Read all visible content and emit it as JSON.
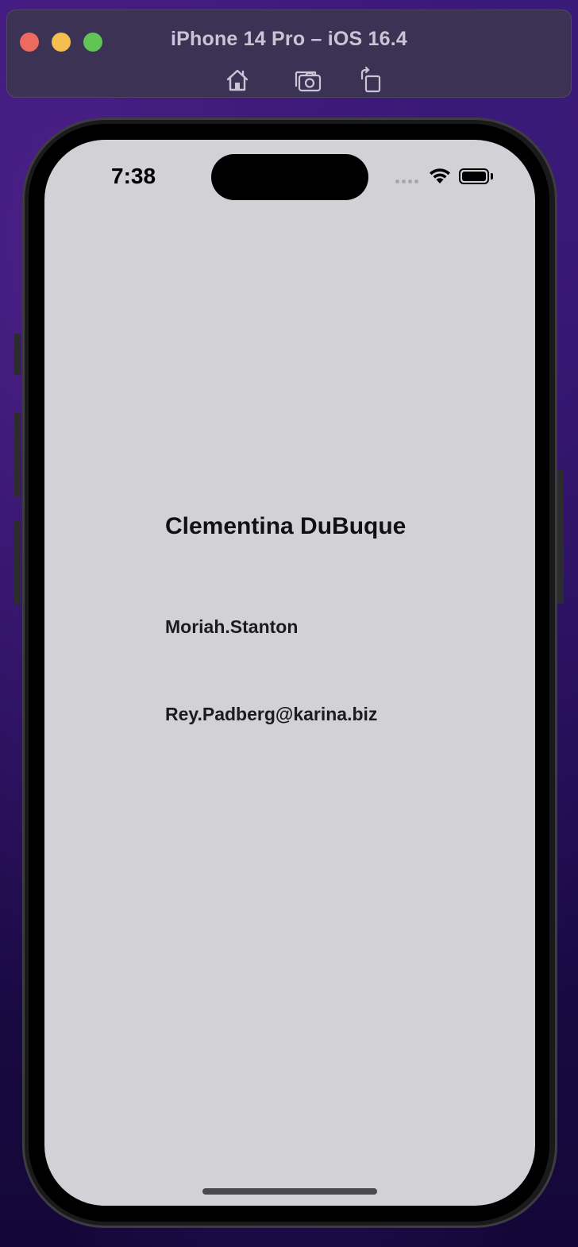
{
  "simulator": {
    "title": "iPhone 14 Pro – iOS 16.4",
    "toolbar": [
      "home-icon",
      "screenshot-icon",
      "rotate-icon"
    ],
    "traffic_lights": {
      "close": "#ed6a5e",
      "minimize": "#f4bf4f",
      "zoom": "#61c454"
    }
  },
  "status_bar": {
    "time": "7:38",
    "icons": [
      "cellular-signal-icon",
      "wifi-icon",
      "battery-icon"
    ]
  },
  "content": {
    "name": "Clementina DuBuque",
    "username": "Moriah.Stanton",
    "email": "Rey.Padberg@karina.biz"
  },
  "colors": {
    "screen_background": "#d1d1d6",
    "text": "#111111"
  }
}
